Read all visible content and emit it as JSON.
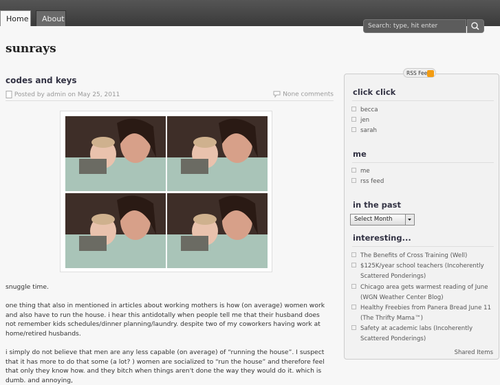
{
  "nav": {
    "tabs": [
      {
        "label": "Home"
      },
      {
        "label": "About"
      }
    ]
  },
  "search": {
    "placeholder": "Search: type, hit enter"
  },
  "site": {
    "title": "sunrays"
  },
  "post": {
    "title": "codes and keys",
    "meta": "Posted by admin on May 25, 2011",
    "comments": "None comments",
    "caption": "snuggle time.",
    "paragraphs": [
      "one thing that also in mentioned in articles about working mothers is how (on average) women work and also have to run the house. i hear this antidotally when people tell me that their husband does not remember kids schedules/dinner planning/laundry. despite two of my coworkers having work at home/retired husbands.",
      "i simply do not believe that men are any less capable (on average) of “running the house”. I suspect that it has more to do that some (a lot? ) women are socialized to “run the house” and therefore feel that only they know how. and they bitch when things aren't done the way they would do it. which is dumb. and annoying,"
    ]
  },
  "sidebar": {
    "rss_label": "RSS Feed",
    "widgets": {
      "click_click": {
        "title": "click click",
        "items": [
          "becca",
          "jen",
          "sarah"
        ]
      },
      "me": {
        "title": "me",
        "items": [
          "me",
          "rss feed"
        ]
      },
      "past": {
        "title": "in the past",
        "select": "Select Month"
      },
      "interesting": {
        "title": "interesting...",
        "items": [
          "The Benefits of Cross Training (Well)",
          "$125K/year school teachers (Incoherently Scattered Ponderings)",
          "Chicago area gets warmest reading of June (WGN Weather Center Blog)",
          "Healthy Freebies from Panera Bread June 11 (The Thrifty Mama™)",
          "Safety at academic labs (Incoherently Scattered Ponderings)"
        ]
      }
    },
    "shared": "Shared Items"
  },
  "icons": {
    "search": "magnifier-icon",
    "post": "document-icon",
    "comments": "speech-bubble-icon",
    "rss": "rss-icon"
  }
}
